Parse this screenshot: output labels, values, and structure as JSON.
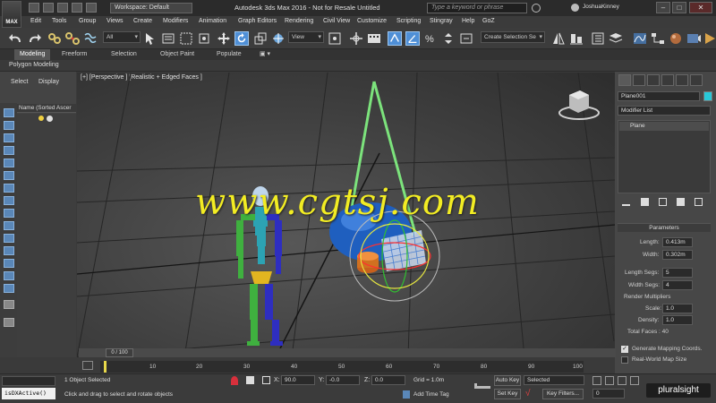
{
  "titlebar": {
    "logo": "MAX",
    "workspace": "Workspace: Default",
    "title": "Autodesk 3ds Max 2016 - Not for Resale   Untitled",
    "search_placeholder": "Type a keyword or phrase",
    "user": "JoshuaKinney"
  },
  "menu": [
    "Edit",
    "Tools",
    "Group",
    "Views",
    "Create",
    "Modifiers",
    "Animation",
    "Graph Editors",
    "Rendering",
    "Civil View",
    "Customize",
    "Scripting",
    "Stingray",
    "Help",
    "GoZ"
  ],
  "toolbar": {
    "filter_value": "All",
    "view_value": "View",
    "selection_set_placeholder": "Create Selection Se"
  },
  "ribbon": {
    "tabs": [
      "Modeling",
      "Freeform",
      "Selection",
      "Object Paint",
      "Populate"
    ],
    "active_tab": "Modeling",
    "subpanel": "Polygon Modeling"
  },
  "scene_explorer": {
    "tabs": [
      "Select",
      "Display"
    ],
    "column_header": "Name (Sorted Ascer"
  },
  "viewport": {
    "label": "[+] [Perspective ] [Realistic + Edged Faces ]"
  },
  "command_panel": {
    "object_name": "Plane001",
    "object_color": "#28c8d8",
    "modifier_list": "Modifier List",
    "stack_item": "Plane",
    "params_title": "Parameters",
    "length_label": "Length:",
    "length_value": "0.413m",
    "width_label": "Width:",
    "width_value": "0.302m",
    "length_segs_label": "Length Segs:",
    "length_segs_value": "5",
    "width_segs_label": "Width Segs:",
    "width_segs_value": "4",
    "render_mult_label": "Render Multipliers",
    "scale_label": "Scale:",
    "scale_value": "1.0",
    "density_label": "Density:",
    "density_value": "1.0",
    "total_faces": "Total Faces : 40",
    "gen_mapping": "Generate Mapping Coords.",
    "real_world": "Real-World Map Size"
  },
  "timeline": {
    "frame_display": "0 / 100",
    "ticks": [
      "10",
      "20",
      "30",
      "40",
      "50",
      "60",
      "70",
      "80",
      "90",
      "100"
    ]
  },
  "status": {
    "maxscript": "isDXActive()",
    "selected": "1 Object Selected",
    "prompt": "Click and drag to select and rotate objects",
    "x_label": "X:",
    "x_value": "90.0",
    "y_label": "Y:",
    "y_value": "-0.0",
    "z_label": "Z:",
    "z_value": "0.0",
    "grid": "Grid = 1.0m",
    "add_time_tag": "Add Time Tag",
    "auto_key": "Auto Key",
    "set_key": "Set Key",
    "selected_dd": "Selected",
    "key_filters": "Key Filters...",
    "frame_field": "0",
    "brand": "pluralsight"
  },
  "watermark": "www.cgtsj.com",
  "colors": {
    "accent_blue": "#4f8fd6",
    "selection_green": "#7ce37c",
    "watermark_yellow": "#f2ec23"
  }
}
